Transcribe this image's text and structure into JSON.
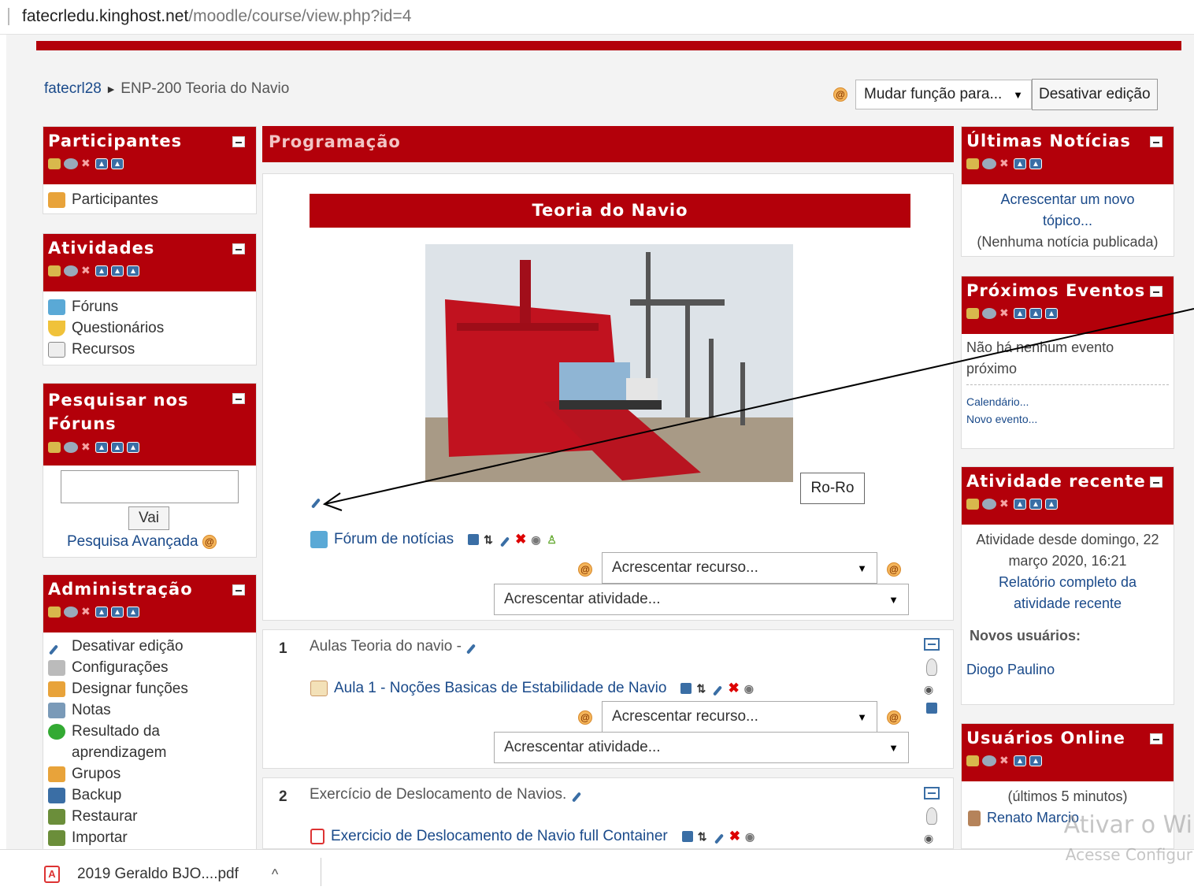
{
  "browser": {
    "url_host": "fatecrledu.kinghost.net",
    "url_path": "/moodle/course/view.php?id=4"
  },
  "breadcrumb": {
    "site": "fatecrl28",
    "sep": "►",
    "course": "ENP-200 Teoria do Navio"
  },
  "header": {
    "role_select": "Mudar função para...",
    "edit_button": "Desativar edição"
  },
  "left": {
    "participantes": {
      "title": "Participantes",
      "items": [
        "Participantes"
      ]
    },
    "atividades": {
      "title": "Atividades",
      "items": [
        "Fóruns",
        "Questionários",
        "Recursos"
      ]
    },
    "pesquisar": {
      "title_line1": "Pesquisar nos",
      "title_line2": "Fóruns",
      "button": "Vai",
      "advanced": "Pesquisa Avançada"
    },
    "admin": {
      "title": "Administração",
      "items": [
        "Desativar edição",
        "Configurações",
        "Designar funções",
        "Notas",
        "Resultado da",
        "aprendizagem",
        "Grupos",
        "Backup",
        "Restaurar",
        "Importar"
      ]
    }
  },
  "main": {
    "title": "Programação",
    "course_banner": "Teoria do Navio",
    "image_caption": "Ro-Ro",
    "forum": "Fórum de notícias",
    "add_resource": "Acrescentar recurso...",
    "add_activity": "Acrescentar atividade...",
    "sections": [
      {
        "num": "1",
        "title": "Aulas Teoria do navio -",
        "item": "Aula 1 - Noções Basicas de Estabilidade de Navio"
      },
      {
        "num": "2",
        "title": "Exercício de Deslocamento de Navios.",
        "item": "Exercicio de Deslocamento de Navio full Container"
      }
    ]
  },
  "right": {
    "news": {
      "title": "Últimas Notícias",
      "line1": "Acrescentar um novo",
      "line2": "tópico...",
      "line3": "(Nenhuma notícia publicada)"
    },
    "events": {
      "title": "Próximos Eventos",
      "line1": "Não há nenhum evento",
      "line2": "próximo",
      "calendar": "Calendário...",
      "new_event": "Novo evento..."
    },
    "recent": {
      "title": "Atividade recente",
      "line1": "Atividade desde domingo, 22",
      "line2": "março 2020, 16:21",
      "link1": "Relatório completo da",
      "link2": "atividade recente",
      "new_users_label": "Novos usuários:",
      "new_user": "Diogo Paulino"
    },
    "online": {
      "title": "Usuários Online",
      "subtitle": "(últimos 5 minutos)",
      "user": "Renato Marcio"
    }
  },
  "watermark": {
    "line1": "Ativar o Wi",
    "line2": "Acesse Configur"
  },
  "download": {
    "file": "2019 Geraldo BJO....pdf",
    "chevron": "^"
  },
  "colors": {
    "brand_red": "#b3000a",
    "link": "#1a4a8a"
  }
}
